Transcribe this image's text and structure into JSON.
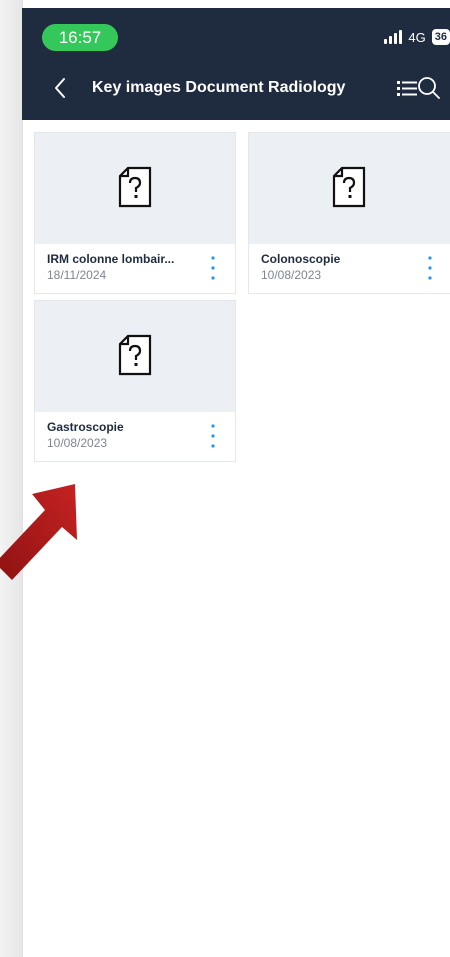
{
  "status": {
    "time": "16:57",
    "network": "4G",
    "battery": "36"
  },
  "header": {
    "title": "Key images Document Radiology",
    "back_icon": "chevron-left-icon",
    "list_icon": "list-icon",
    "search_icon": "search-icon"
  },
  "documents": [
    {
      "name": "IRM colonne lombair...",
      "date": "18/11/2024",
      "icon": "unknown-file-icon"
    },
    {
      "name": "Colonoscopie",
      "date": "10/08/2023",
      "icon": "unknown-file-icon"
    },
    {
      "name": "Gastroscopie",
      "date": "10/08/2023",
      "icon": "unknown-file-icon"
    }
  ],
  "colors": {
    "header_bg": "#1f2b3e",
    "time_pill": "#34c759",
    "accent": "#2196f3",
    "arrow": "#b51c1c"
  }
}
